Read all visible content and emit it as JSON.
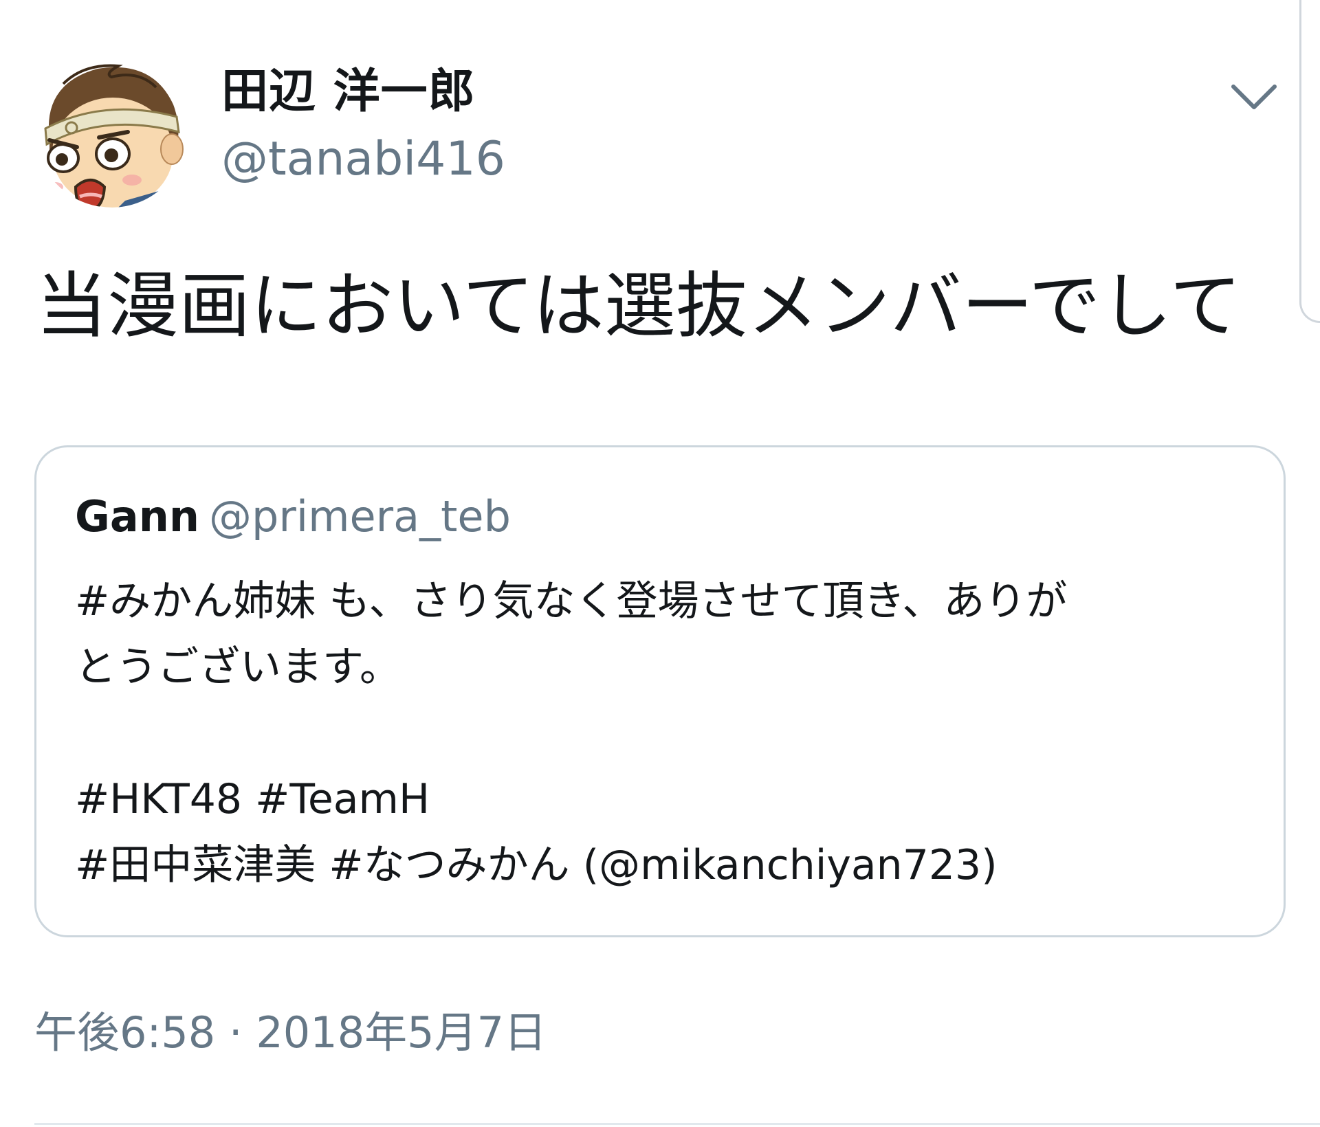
{
  "tweet": {
    "author": {
      "display_name": "田辺 洋一郎",
      "handle": "@tanabi416",
      "avatar_icon": "cartoon-avatar-icon"
    },
    "menu_icon": "chevron-down-icon",
    "text": "当漫画においては選抜メンバーでして",
    "quoted_tweet": {
      "author_name": "Gann",
      "author_handle": "@primera_teb",
      "lines": [
        "#みかん姉妹 も、さり気なく登場させて頂き、ありが",
        "とうございます。",
        "",
        "#HKT48 #TeamH",
        "#田中菜津美 #なつみかん (@mikanchiyan723)"
      ]
    },
    "timestamp": "午後6:58 · 2018年5月7日"
  },
  "colors": {
    "text_primary": "#14171a",
    "text_secondary": "#657786",
    "card_border": "#ccd6dd",
    "background": "#ffffff"
  }
}
